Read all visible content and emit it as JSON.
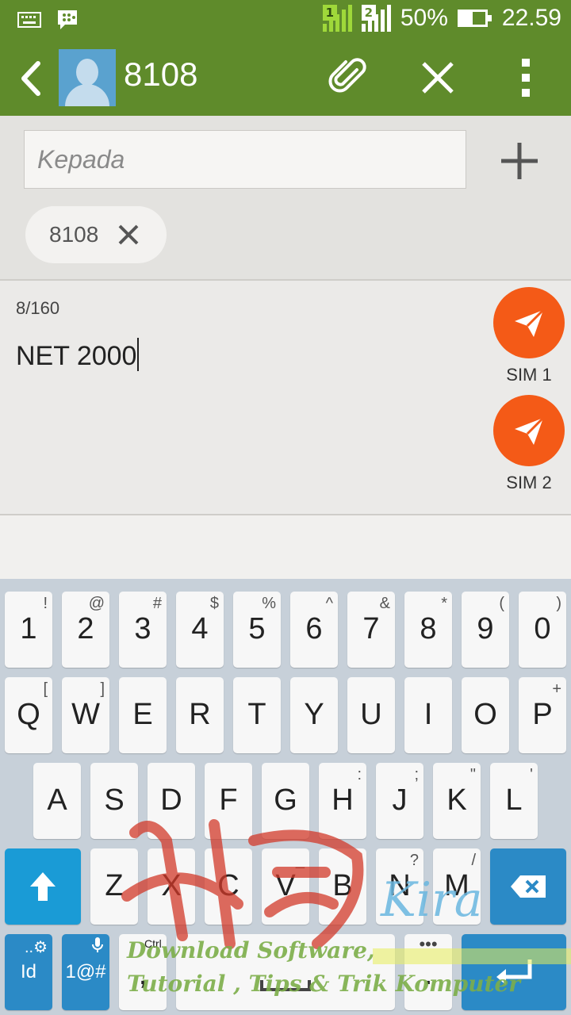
{
  "status_bar": {
    "sim1_label": "1",
    "sim2_label": "2",
    "battery": "50%",
    "battery_level": 0.5,
    "time": "22.59"
  },
  "app_bar": {
    "title": "8108"
  },
  "recipients": {
    "to_placeholder": "Kepada",
    "chip_label": "8108"
  },
  "compose": {
    "counter": "8/160",
    "message": "NET 2000"
  },
  "send": [
    {
      "label": "SIM 1"
    },
    {
      "label": "SIM 2"
    }
  ],
  "keyboard": {
    "row1": [
      {
        "main": "1",
        "sub": "!"
      },
      {
        "main": "2",
        "sub": "@"
      },
      {
        "main": "3",
        "sub": "#"
      },
      {
        "main": "4",
        "sub": "$"
      },
      {
        "main": "5",
        "sub": "%"
      },
      {
        "main": "6",
        "sub": "^"
      },
      {
        "main": "7",
        "sub": "&"
      },
      {
        "main": "8",
        "sub": "*"
      },
      {
        "main": "9",
        "sub": "("
      },
      {
        "main": "0",
        "sub": ")"
      }
    ],
    "row2": [
      {
        "main": "Q",
        "sub": "["
      },
      {
        "main": "W",
        "sub": "]"
      },
      {
        "main": "E",
        "sub": ""
      },
      {
        "main": "R",
        "sub": ""
      },
      {
        "main": "T",
        "sub": ""
      },
      {
        "main": "Y",
        "sub": ""
      },
      {
        "main": "U",
        "sub": ""
      },
      {
        "main": "I",
        "sub": ""
      },
      {
        "main": "O",
        "sub": ""
      },
      {
        "main": "P",
        "sub": "+"
      }
    ],
    "row3": [
      {
        "main": "A",
        "sub": ""
      },
      {
        "main": "S",
        "sub": ""
      },
      {
        "main": "D",
        "sub": ""
      },
      {
        "main": "F",
        "sub": ""
      },
      {
        "main": "G",
        "sub": ""
      },
      {
        "main": "H",
        "sub": ":"
      },
      {
        "main": "J",
        "sub": ";"
      },
      {
        "main": "K",
        "sub": "\""
      },
      {
        "main": "L",
        "sub": "'"
      }
    ],
    "row4": [
      {
        "main": "Z",
        "sub": ""
      },
      {
        "main": "X",
        "sub": ""
      },
      {
        "main": "C",
        "sub": ""
      },
      {
        "main": "V",
        "sub": "_"
      },
      {
        "main": "B",
        "sub": ""
      },
      {
        "main": "N",
        "sub": "?"
      },
      {
        "main": "M",
        "sub": "/"
      }
    ],
    "lang_label": "Id",
    "symbols_label": "1@#",
    "ctrl_label": "Ctrl",
    "comma_label": ",",
    "period_label": "."
  },
  "watermark": {
    "line1": "Download Software,",
    "line2": "Tutorial , Tips & Trik Komputer",
    "brand": "Kira"
  },
  "colors": {
    "header": "#5f8b2b",
    "send": "#f45a17",
    "keyboard_bg": "#c7d0d9",
    "accent_key": "#1a9bd6"
  }
}
